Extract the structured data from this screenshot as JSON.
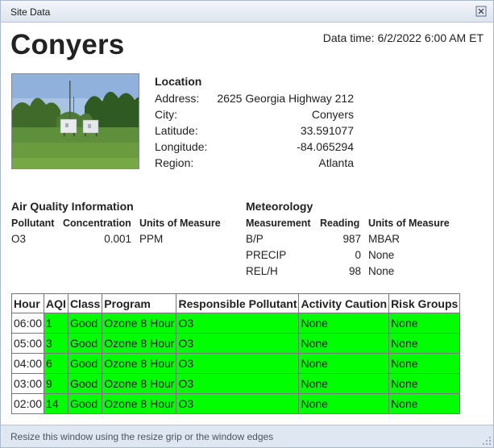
{
  "window": {
    "title": "Site Data"
  },
  "site": {
    "name": "Conyers",
    "data_time_label": "Data time:",
    "data_time": "6/2/2022 6:00 AM ET"
  },
  "location": {
    "heading": "Location",
    "rows": [
      {
        "label": "Address:",
        "value": "2625 Georgia Highway 212"
      },
      {
        "label": "City:",
        "value": "Conyers"
      },
      {
        "label": "Latitude:",
        "value": "33.591077"
      },
      {
        "label": "Longitude:",
        "value": "-84.065294"
      },
      {
        "label": "Region:",
        "value": "Atlanta"
      }
    ]
  },
  "air_quality": {
    "heading": "Air Quality Information",
    "columns": [
      "Pollutant",
      "Concentration",
      "Units of Measure"
    ],
    "rows": [
      {
        "pollutant": "O3",
        "concentration": "0.001",
        "units": "PPM"
      }
    ]
  },
  "meteorology": {
    "heading": "Meteorology",
    "columns": [
      "Measurement",
      "Reading",
      "Units of Measure"
    ],
    "rows": [
      {
        "measurement": "B/P",
        "reading": "987",
        "units": "MBAR"
      },
      {
        "measurement": "PRECIP",
        "reading": "0",
        "units": "None"
      },
      {
        "measurement": "REL/H",
        "reading": "98",
        "units": "None"
      }
    ]
  },
  "hourly": {
    "columns": [
      "Hour",
      "AQI",
      "Class",
      "Program",
      "Responsible Pollutant",
      "Activity Caution",
      "Risk Groups"
    ],
    "rows": [
      [
        "06:00",
        "1",
        "Good",
        "Ozone 8 Hour",
        "O3",
        "None",
        "None"
      ],
      [
        "05:00",
        "3",
        "Good",
        "Ozone 8 Hour",
        "O3",
        "None",
        "None"
      ],
      [
        "04:00",
        "6",
        "Good",
        "Ozone 8 Hour",
        "O3",
        "None",
        "None"
      ],
      [
        "03:00",
        "9",
        "Good",
        "Ozone 8 Hour",
        "O3",
        "None",
        "None"
      ],
      [
        "02:00",
        "14",
        "Good",
        "Ozone 8 Hour",
        "O3",
        "None",
        "None"
      ]
    ],
    "good_color": "#00ff00"
  },
  "status": {
    "message": "Resize this window using the resize grip or the window edges"
  }
}
